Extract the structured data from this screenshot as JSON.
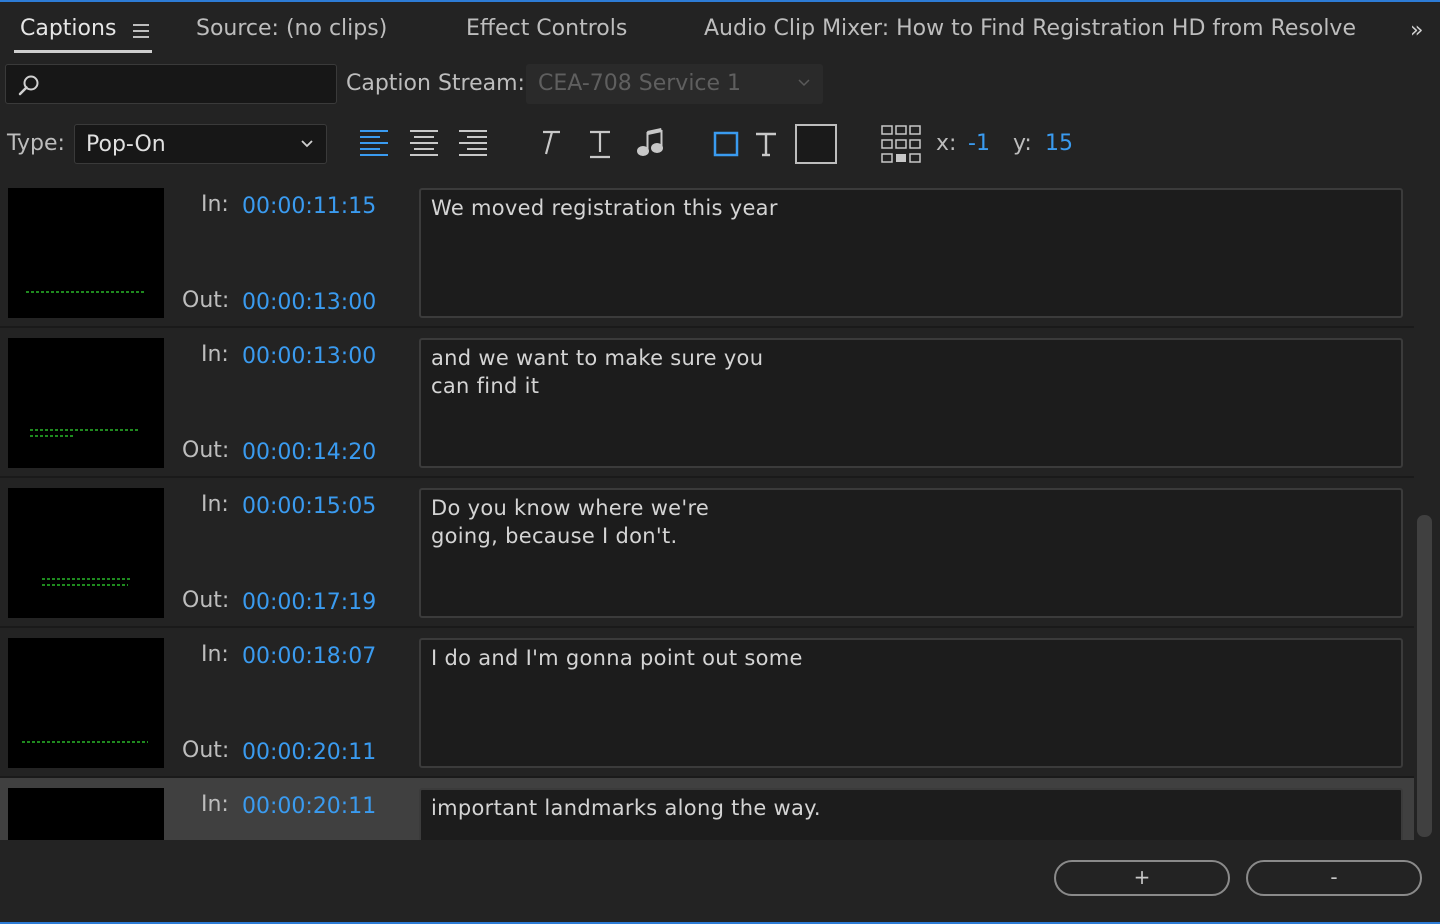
{
  "tabs": [
    {
      "label": "Captions"
    },
    {
      "label": "Source: (no clips)"
    },
    {
      "label": "Effect Controls"
    },
    {
      "label": "Audio Clip Mixer: How to Find Registration HD from Resolve"
    }
  ],
  "overflow_glyph": "»",
  "search": {
    "placeholder": ""
  },
  "caption_stream": {
    "label": "Caption Stream:",
    "value": "CEA-708 Service 1"
  },
  "type": {
    "label": "Type:",
    "value": "Pop-On"
  },
  "position": {
    "x_label": "x:",
    "x_value": "-1",
    "y_label": "y:",
    "y_value": "15"
  },
  "colors": {
    "accent": "#3a9bf0",
    "timecode": "#3a9bf0",
    "frame": "#2d7cd6"
  },
  "captions": [
    {
      "in_label": "In:",
      "in": "00:00:11:15",
      "out_label": "Out:",
      "out": "00:00:13:00",
      "text": "We moved registration this year"
    },
    {
      "in_label": "In:",
      "in": "00:00:13:00",
      "out_label": "Out:",
      "out": "00:00:14:20",
      "text": "and we want to make sure you\ncan find it"
    },
    {
      "in_label": "In:",
      "in": "00:00:15:05",
      "out_label": "Out:",
      "out": "00:00:17:19",
      "text": "Do you know where we're\ngoing, because I don't."
    },
    {
      "in_label": "In:",
      "in": "00:00:18:07",
      "out_label": "Out:",
      "out": "00:00:20:11",
      "text": "I do and I'm gonna point out some"
    },
    {
      "in_label": "In:",
      "in": "00:00:20:11",
      "out_label": "",
      "out": "",
      "text": "important landmarks along the way."
    }
  ],
  "buttons": {
    "add": "+",
    "remove": "-"
  }
}
